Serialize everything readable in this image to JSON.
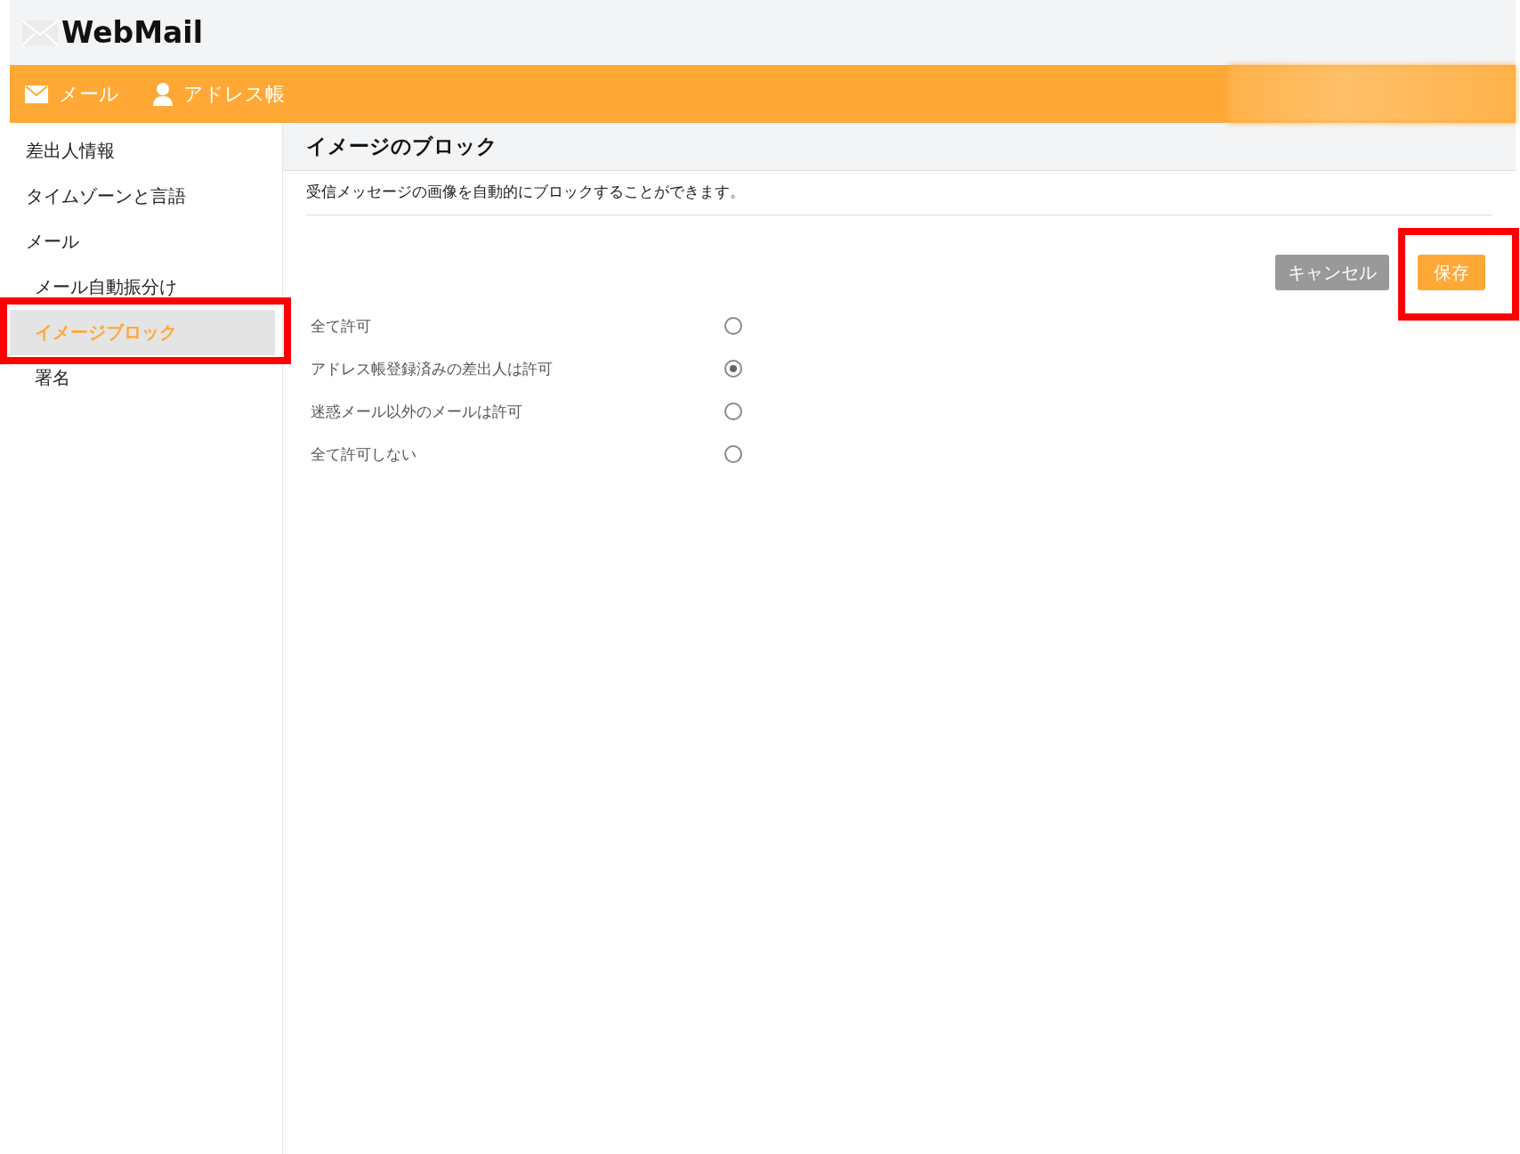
{
  "logo": {
    "text": "WebMail"
  },
  "nav": [
    {
      "label": "メール",
      "kind": "mail"
    },
    {
      "label": "アドレス帳",
      "kind": "person"
    }
  ],
  "sidebar": {
    "items": [
      {
        "label": "差出人情報",
        "selected": false
      },
      {
        "label": "タイムゾーンと言語",
        "selected": false
      },
      {
        "label": "メール",
        "selected": false,
        "children": [
          {
            "label": "メール自動振分け",
            "selected": false
          },
          {
            "label": "イメージブロック",
            "selected": true,
            "highlighted": true
          },
          {
            "label": "署名",
            "selected": false
          }
        ]
      }
    ]
  },
  "content": {
    "title": "イメージのブロック",
    "description": "受信メッセージの画像を自動的にブロックすることができます。",
    "buttons": [
      {
        "label": "キャンセル",
        "kind": "secondary"
      },
      {
        "label": "保存",
        "kind": "primary",
        "highlighted": true
      }
    ],
    "options": [
      {
        "label": "全て許可",
        "selected": false
      },
      {
        "label": "アドレス帳登録済みの差出人は許可",
        "selected": true
      },
      {
        "label": "迷惑メール以外のメールは許可",
        "selected": false
      },
      {
        "label": "全て許可しない",
        "selected": false
      }
    ]
  }
}
